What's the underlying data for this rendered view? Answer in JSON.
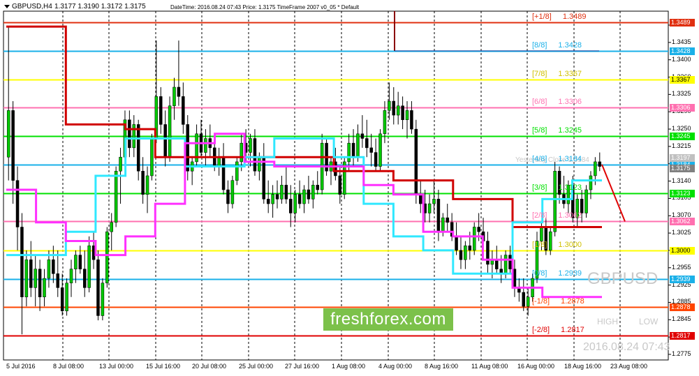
{
  "header": {
    "symbol": "GBPUSD,H4",
    "ohlc": "1.3177 1.3190 1.3172 1.3175",
    "info": "DateTime: 2016.08.24 07:43   Price: 1.3175   TimeFrame 2007 v0_05   *   Default"
  },
  "watermark": {
    "symbol": "GBPUSD",
    "high_label": "HIGH",
    "low_label": "LOW",
    "datetime": "2016.08.24 07:43",
    "yesterday_close": "Yesterday Close 1.3184"
  },
  "banner": {
    "text": "freshforex.com",
    "color": "#7cc14a"
  },
  "chart_data": {
    "type": "candlestick",
    "symbol": "GBPUSD",
    "timeframe": "H4",
    "ylim": [
      1.2765,
      1.3513
    ],
    "y_ticks": [
      "1.3475",
      "1.3435",
      "1.3400",
      "1.3360",
      "1.3325",
      "1.3290",
      "1.3250",
      "1.3215",
      "1.3175",
      "1.3140",
      "1.3105",
      "1.3070",
      "1.3025",
      "1.2995",
      "1.2955",
      "1.2925",
      "1.2885",
      "1.2845",
      "1.2810",
      "1.2775"
    ],
    "x_ticks": [
      "5 Jul 2016",
      "8 Jul 08:00",
      "13 Jul 00:00",
      "15 Jul 16:00",
      "20 Jul 08:00",
      "25 Jul 00:00",
      "27 Jul 16:00",
      "1 Aug 08:00",
      "4 Aug 00:00",
      "8 Aug 16:00",
      "11 Aug 08:00",
      "16 Aug 00:00",
      "18 Aug 16:00",
      "23 Aug 08:00"
    ],
    "murrey_levels": [
      {
        "label": "[+1/8]",
        "value": "1.3489",
        "price": 1.3489,
        "color": "#e03010"
      },
      {
        "label": "[8/8]",
        "value": "1.3428",
        "price": 1.3428,
        "color": "#1ab0e8"
      },
      {
        "label": "[7/8]",
        "value": "1.3367",
        "price": 1.3367,
        "color": "#ffff00"
      },
      {
        "label": "[6/8]",
        "value": "1.3306",
        "price": 1.3306,
        "color": "#ff70b0"
      },
      {
        "label": "[5/8]",
        "value": "1.3245",
        "price": 1.3245,
        "color": "#00e000"
      },
      {
        "label": "[4/8]",
        "value": "1.3184",
        "price": 1.3184,
        "color": "#1ab0e8"
      },
      {
        "label": "[3/8]",
        "value": "1.3123",
        "price": 1.3123,
        "color": "#00e000"
      },
      {
        "label": "[2/8]",
        "value": "1.3062",
        "price": 1.3062,
        "color": "#ff70b0"
      },
      {
        "label": "[1/8]",
        "value": "1.3000",
        "price": 1.3,
        "color": "#ffff00"
      },
      {
        "label": "[0/8]",
        "value": "1.2939",
        "price": 1.2939,
        "color": "#1ab0e8"
      },
      {
        "label": "[-1/8]",
        "value": "1.2878",
        "price": 1.2878,
        "color": "#ff4500"
      },
      {
        "label": "[-2/8]",
        "value": "1.2817",
        "price": 1.2817,
        "color": "#e00000"
      }
    ],
    "price_badges": [
      {
        "value": "1.3197",
        "price": 1.3197,
        "color": "#c0c0c0"
      },
      {
        "value": "1.3175",
        "price": 1.3175,
        "color": "#808080"
      }
    ],
    "candles": [
      [
        1.32,
        1.348,
        1.315,
        1.33
      ],
      [
        1.33,
        1.332,
        1.31,
        1.315
      ],
      [
        1.315,
        1.318,
        1.3,
        1.305
      ],
      [
        1.305,
        1.308,
        1.282,
        1.29
      ],
      [
        1.29,
        1.3,
        1.288,
        1.298
      ],
      [
        1.298,
        1.302,
        1.29,
        1.292
      ],
      [
        1.292,
        1.299,
        1.288,
        1.296
      ],
      [
        1.296,
        1.298,
        1.287,
        1.29
      ],
      [
        1.29,
        1.296,
        1.288,
        1.294
      ],
      [
        1.294,
        1.3,
        1.292,
        1.298
      ],
      [
        1.298,
        1.301,
        1.293,
        1.295
      ],
      [
        1.295,
        1.3,
        1.29,
        1.292
      ],
      [
        1.292,
        1.295,
        1.286,
        1.287
      ],
      [
        1.287,
        1.294,
        1.286,
        1.293
      ],
      [
        1.293,
        1.298,
        1.29,
        1.296
      ],
      [
        1.296,
        1.3,
        1.293,
        1.299
      ],
      [
        1.299,
        1.301,
        1.295,
        1.296
      ],
      [
        1.296,
        1.3,
        1.29,
        1.292
      ],
      [
        1.292,
        1.303,
        1.291,
        1.301
      ],
      [
        1.301,
        1.304,
        1.296,
        1.298
      ],
      [
        1.298,
        1.3,
        1.285,
        1.286
      ],
      [
        1.286,
        1.294,
        1.285,
        1.293
      ],
      [
        1.293,
        1.305,
        1.292,
        1.304
      ],
      [
        1.304,
        1.308,
        1.3,
        1.306
      ],
      [
        1.306,
        1.318,
        1.305,
        1.317
      ],
      [
        1.317,
        1.322,
        1.31,
        1.32
      ],
      [
        1.32,
        1.33,
        1.318,
        1.328
      ],
      [
        1.328,
        1.33,
        1.32,
        1.322
      ],
      [
        1.322,
        1.329,
        1.32,
        1.327
      ],
      [
        1.327,
        1.328,
        1.315,
        1.317
      ],
      [
        1.317,
        1.32,
        1.31,
        1.312
      ],
      [
        1.312,
        1.318,
        1.308,
        1.316
      ],
      [
        1.316,
        1.325,
        1.315,
        1.324
      ],
      [
        1.324,
        1.345,
        1.323,
        1.333
      ],
      [
        1.333,
        1.335,
        1.325,
        1.327
      ],
      [
        1.327,
        1.33,
        1.318,
        1.32
      ],
      [
        1.32,
        1.333,
        1.319,
        1.331
      ],
      [
        1.331,
        1.337,
        1.328,
        1.335
      ],
      [
        1.335,
        1.345,
        1.331,
        1.333
      ],
      [
        1.333,
        1.336,
        1.325,
        1.327
      ],
      [
        1.327,
        1.329,
        1.315,
        1.317
      ],
      [
        1.317,
        1.32,
        1.314,
        1.319
      ],
      [
        1.319,
        1.327,
        1.318,
        1.325
      ],
      [
        1.325,
        1.328,
        1.32,
        1.321
      ],
      [
        1.321,
        1.326,
        1.318,
        1.324
      ],
      [
        1.324,
        1.327,
        1.32,
        1.322
      ],
      [
        1.322,
        1.324,
        1.317,
        1.318
      ],
      [
        1.318,
        1.322,
        1.316,
        1.32
      ],
      [
        1.32,
        1.323,
        1.312,
        1.313
      ],
      [
        1.313,
        1.315,
        1.308,
        1.31
      ],
      [
        1.31,
        1.316,
        1.309,
        1.315
      ],
      [
        1.315,
        1.32,
        1.314,
        1.319
      ],
      [
        1.319,
        1.325,
        1.317,
        1.323
      ],
      [
        1.323,
        1.326,
        1.319,
        1.321
      ],
      [
        1.321,
        1.325,
        1.318,
        1.324
      ],
      [
        1.324,
        1.326,
        1.316,
        1.317
      ],
      [
        1.317,
        1.321,
        1.315,
        1.32
      ],
      [
        1.32,
        1.323,
        1.31,
        1.311
      ],
      [
        1.311,
        1.315,
        1.308,
        1.31
      ],
      [
        1.31,
        1.314,
        1.307,
        1.312
      ],
      [
        1.312,
        1.315,
        1.309,
        1.311
      ],
      [
        1.311,
        1.316,
        1.31,
        1.314
      ],
      [
        1.314,
        1.318,
        1.31,
        1.311
      ],
      [
        1.311,
        1.314,
        1.305,
        1.308
      ],
      [
        1.308,
        1.313,
        1.306,
        1.312
      ],
      [
        1.312,
        1.315,
        1.309,
        1.31
      ],
      [
        1.31,
        1.314,
        1.308,
        1.313
      ],
      [
        1.313,
        1.316,
        1.31,
        1.311
      ],
      [
        1.311,
        1.315,
        1.309,
        1.314
      ],
      [
        1.314,
        1.317,
        1.312,
        1.313
      ],
      [
        1.313,
        1.325,
        1.312,
        1.323
      ],
      [
        1.323,
        1.324,
        1.316,
        1.317
      ],
      [
        1.317,
        1.32,
        1.314,
        1.319
      ],
      [
        1.319,
        1.322,
        1.315,
        1.316
      ],
      [
        1.316,
        1.318,
        1.31,
        1.312
      ],
      [
        1.312,
        1.32,
        1.311,
        1.319
      ],
      [
        1.319,
        1.325,
        1.317,
        1.323
      ],
      [
        1.323,
        1.326,
        1.318,
        1.32
      ],
      [
        1.32,
        1.327,
        1.319,
        1.325
      ],
      [
        1.325,
        1.329,
        1.322,
        1.324
      ],
      [
        1.324,
        1.328,
        1.32,
        1.322
      ],
      [
        1.322,
        1.325,
        1.318,
        1.321
      ],
      [
        1.321,
        1.324,
        1.317,
        1.318
      ],
      [
        1.318,
        1.326,
        1.317,
        1.325
      ],
      [
        1.325,
        1.332,
        1.323,
        1.33
      ],
      [
        1.33,
        1.336,
        1.328,
        1.332
      ],
      [
        1.332,
        1.335,
        1.327,
        1.329
      ],
      [
        1.329,
        1.334,
        1.327,
        1.331
      ],
      [
        1.331,
        1.333,
        1.326,
        1.328
      ],
      [
        1.328,
        1.332,
        1.324,
        1.33
      ],
      [
        1.33,
        1.332,
        1.325,
        1.326
      ],
      [
        1.326,
        1.328,
        1.31,
        1.312
      ],
      [
        1.312,
        1.315,
        1.308,
        1.31
      ],
      [
        1.31,
        1.313,
        1.306,
        1.308
      ],
      [
        1.308,
        1.312,
        1.306,
        1.31
      ],
      [
        1.31,
        1.315,
        1.308,
        1.311
      ],
      [
        1.311,
        1.313,
        1.302,
        1.304
      ],
      [
        1.304,
        1.308,
        1.303,
        1.307
      ],
      [
        1.307,
        1.31,
        1.304,
        1.306
      ],
      [
        1.306,
        1.308,
        1.302,
        1.303
      ],
      [
        1.303,
        1.306,
        1.299,
        1.3
      ],
      [
        1.3,
        1.303,
        1.296,
        1.298
      ],
      [
        1.298,
        1.302,
        1.296,
        1.301
      ],
      [
        1.301,
        1.304,
        1.298,
        1.3
      ],
      [
        1.3,
        1.306,
        1.299,
        1.305
      ],
      [
        1.305,
        1.308,
        1.302,
        1.304
      ],
      [
        1.304,
        1.307,
        1.3,
        1.302
      ],
      [
        1.302,
        1.304,
        1.295,
        1.297
      ],
      [
        1.297,
        1.3,
        1.294,
        1.298
      ],
      [
        1.298,
        1.301,
        1.295,
        1.296
      ],
      [
        1.296,
        1.299,
        1.293,
        1.295
      ],
      [
        1.295,
        1.3,
        1.294,
        1.299
      ],
      [
        1.299,
        1.301,
        1.295,
        1.296
      ],
      [
        1.296,
        1.298,
        1.29,
        1.292
      ],
      [
        1.292,
        1.294,
        1.289,
        1.291
      ],
      [
        1.291,
        1.294,
        1.287,
        1.288
      ],
      [
        1.288,
        1.292,
        1.286,
        1.29
      ],
      [
        1.29,
        1.295,
        1.289,
        1.294
      ],
      [
        1.294,
        1.304,
        1.293,
        1.302
      ],
      [
        1.302,
        1.306,
        1.3,
        1.305
      ],
      [
        1.305,
        1.307,
        1.299,
        1.3
      ],
      [
        1.3,
        1.305,
        1.299,
        1.304
      ],
      [
        1.304,
        1.319,
        1.303,
        1.317
      ],
      [
        1.317,
        1.318,
        1.31,
        1.312
      ],
      [
        1.312,
        1.316,
        1.309,
        1.31
      ],
      [
        1.31,
        1.315,
        1.308,
        1.314
      ],
      [
        1.314,
        1.316,
        1.306,
        1.307
      ],
      [
        1.307,
        1.312,
        1.305,
        1.311
      ],
      [
        1.311,
        1.313,
        1.306,
        1.308
      ],
      [
        1.308,
        1.314,
        1.307,
        1.313
      ],
      [
        1.313,
        1.317,
        1.311,
        1.316
      ],
      [
        1.316,
        1.32,
        1.314,
        1.319
      ],
      [
        1.319,
        1.321,
        1.317,
        1.318
      ]
    ],
    "ma_red": [
      1.348,
      1.348,
      1.327,
      1.327,
      1.326,
      1.32,
      1.32,
      1.32,
      1.32,
      1.32,
      1.32,
      1.317,
      1.317,
      1.315,
      1.315,
      1.311,
      1.311,
      1.305,
      1.305,
      1.305
    ],
    "ma_cyan": [
      1.299,
      1.299,
      1.304,
      1.316,
      1.324,
      1.324,
      1.318,
      1.318,
      1.32,
      1.324,
      1.324,
      1.32,
      1.31,
      1.303,
      1.3,
      1.295,
      1.295,
      1.306,
      1.311,
      1.315
    ],
    "ma_magenta": [
      1.313,
      1.306,
      1.302,
      1.299,
      1.303,
      1.31,
      1.323,
      1.325,
      1.319,
      1.318,
      1.318,
      1.318,
      1.314,
      1.312,
      1.304,
      1.303,
      1.298,
      1.292,
      1.29,
      1.29
    ],
    "projection": [
      [
        1.3184,
        1.3062
      ]
    ]
  }
}
